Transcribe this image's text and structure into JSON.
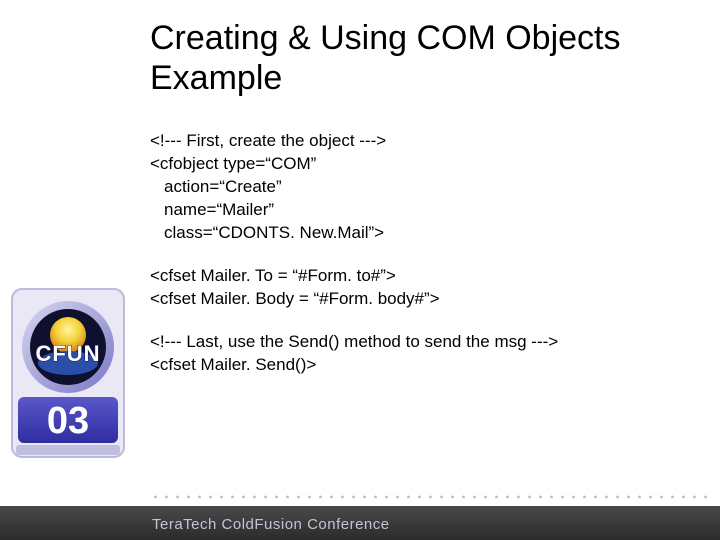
{
  "title": "Creating & Using COM Objects Example",
  "code": {
    "block1": {
      "l1": "<!--- First, create the object --->",
      "l2": "<cfobject type=“COM”",
      "l3": "action=“Create”",
      "l4": "name=“Mailer”",
      "l5": "class=“CDONTS. New.Mail”>"
    },
    "block2": {
      "l1": "<cfset Mailer. To = “#Form. to#”>",
      "l2": "<cfset Mailer. Body = “#Form. body#”>"
    },
    "block3": {
      "l1": "<!--- Last, use the Send() method to send the msg --->",
      "l2": "<cfset Mailer. Send()>"
    }
  },
  "badge": {
    "top_text": "CFUN",
    "year": "03"
  },
  "footer": "TeraTech ColdFusion Conference"
}
